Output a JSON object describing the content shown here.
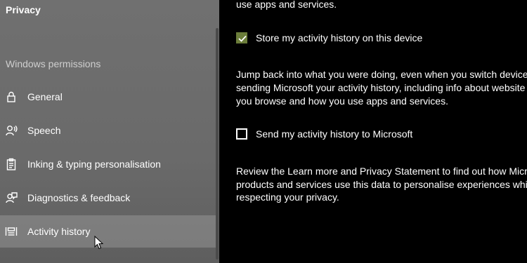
{
  "app": {
    "title": "Privacy"
  },
  "sidebar": {
    "section_heading": "Windows permissions",
    "items": [
      {
        "label": "General",
        "icon": "lock-icon"
      },
      {
        "label": "Speech",
        "icon": "speech-icon"
      },
      {
        "label": "Inking & typing personalisation",
        "icon": "clipboard-icon"
      },
      {
        "label": "Diagnostics & feedback",
        "icon": "feedback-icon"
      },
      {
        "label": "Activity history",
        "icon": "activity-history-icon",
        "selected": true
      }
    ]
  },
  "main": {
    "top_text": "use apps and services.",
    "store_history": {
      "label": "Store my activity history on this device",
      "checked": true
    },
    "paragraph1": [
      "Jump back into what you were doing, even when you switch device",
      "sending Microsoft your activity history, including info about website",
      "you browse and how you use apps and services."
    ],
    "send_history": {
      "label": "Send my activity history to Microsoft",
      "checked": false
    },
    "paragraph2": [
      "Review the Learn more and Privacy Statement to find out how Micro",
      "products and services use this data to personalise experiences while",
      "respecting your privacy."
    ]
  },
  "colors": {
    "accent": "#6b7d3a",
    "sidebar_bg": "#6a6a6a",
    "main_bg": "#000000"
  }
}
